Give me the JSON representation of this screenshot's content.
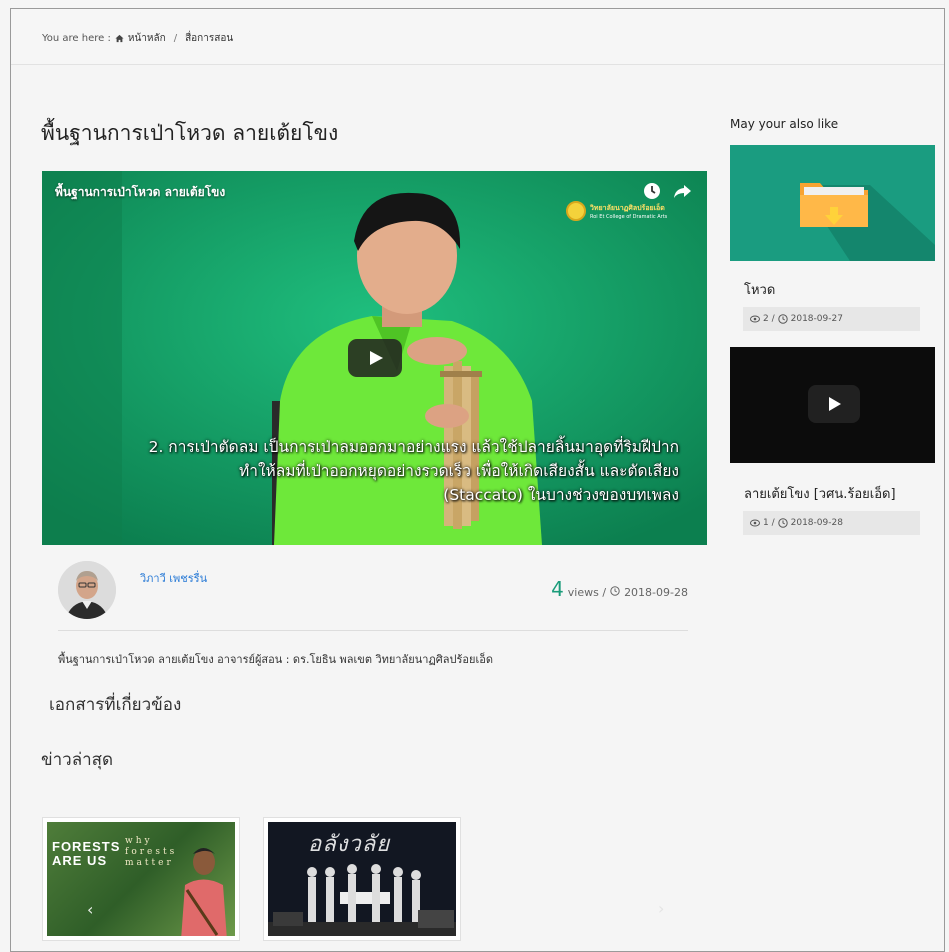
{
  "breadcrumb": {
    "prefix": "You are here :",
    "home": "หน้าหลัก",
    "separator": "/",
    "current": "สื่อการสอน"
  },
  "article": {
    "title": "พื้นฐานการเป่าโหวด ลายเต้ยโขง",
    "video": {
      "title": "พื้นฐานการเป่าโหวด ลายเต้ยโขง",
      "logo_th": "วิทยาลัยนาฏศิลปร้อยเอ็ด",
      "logo_en": "Roi Et College of Dramatic Arts",
      "subtitle_lines": [
        "2. การเป่าตัดลม เป็นการเป่าลมออกมาอย่างแรง แล้วใช้ปลายลิ้นมาอุดที่ริมฝีปาก",
        "ทำให้ลมที่เป่าออกหยุดอย่างรวดเร็ว เพื่อให้เกิดเสียงสั้น และตัดเสียง",
        "(Staccato) ในบางช่วงของบทเพลง"
      ]
    },
    "author": "วิภาวี เพชรรื่น",
    "views_count": "4",
    "views_label": "views /",
    "date": "2018-09-28",
    "description": "พื้นฐานการเป่าโหวด ลายเต้ยโขง อาจารย์ผู้สอน : ดร.โยธิน พลเขต วิทยาลัยนาฏศิลปร้อยเอ็ด"
  },
  "related_heading": "เอกสารที่เกี่ยวข้อง",
  "news_heading": "ข่าวล่าสุด",
  "news": [
    {
      "forests_title": "FORESTS ARE US",
      "why_text": "why forests matter"
    },
    {
      "stage_title": "อลังวลัย"
    }
  ],
  "sidebar": {
    "title": "May your also like",
    "items": [
      {
        "title": "โหวด",
        "meta": "2 / ",
        "date": "2018-09-27"
      },
      {
        "title": "ลายเต้ยโขง [วศน.ร้อยเอ็ด]",
        "meta": "1 / ",
        "date": "2018-09-28"
      }
    ]
  },
  "colors": {
    "link": "#2a7bd6",
    "views": "#1a9c7a",
    "folder_bg": "#1a9c80"
  }
}
